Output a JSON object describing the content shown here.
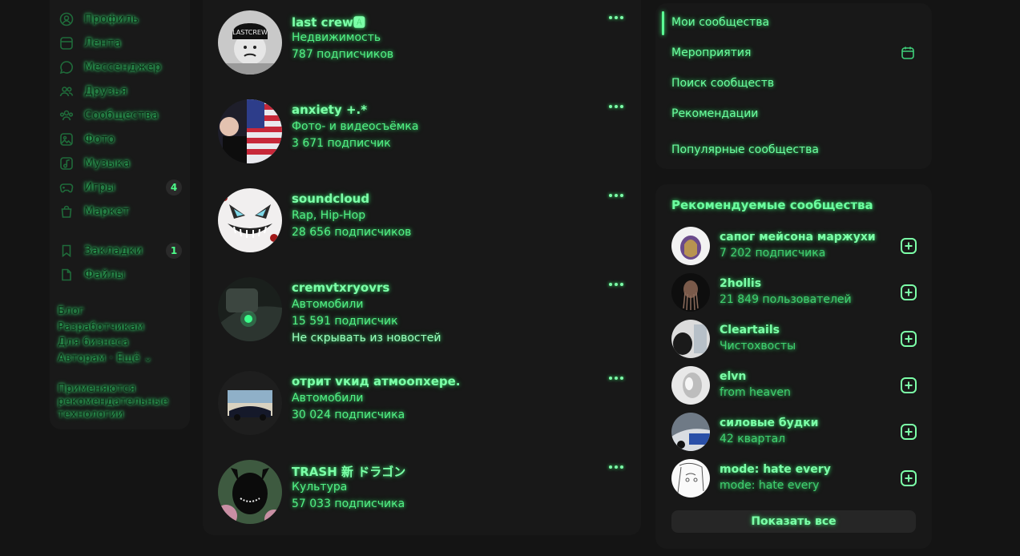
{
  "nav": {
    "items": [
      {
        "label": "Профиль",
        "icon": "user-circle-icon"
      },
      {
        "label": "Лента",
        "icon": "feed-icon"
      },
      {
        "label": "Мессенджер",
        "icon": "chat-bubble-icon"
      },
      {
        "label": "Друзья",
        "icon": "friends-icon"
      },
      {
        "label": "Сообщества",
        "icon": "communities-icon"
      },
      {
        "label": "Фото",
        "icon": "photo-icon"
      },
      {
        "label": "Музыка",
        "icon": "music-icon"
      },
      {
        "label": "Игры",
        "icon": "gamepad-icon",
        "count": "4"
      },
      {
        "label": "Маркет",
        "icon": "shopping-bag-icon"
      },
      {
        "label": "Закладки",
        "icon": "bookmark-icon",
        "count": "1"
      },
      {
        "label": "Файлы",
        "icon": "file-icon"
      }
    ],
    "footer_links": [
      "Блог",
      "Разработчикам",
      "Для бизнеса",
      "Авторам · Ещё ⌄"
    ],
    "footer_note": [
      "Применяются",
      "рекомендательные",
      "технологии"
    ]
  },
  "groups": [
    {
      "name": "last crew🅰",
      "category": "Недвижимость",
      "subscribers": "787 подписчиков"
    },
    {
      "name": "anxiety +.*",
      "category": "Фото- и видеосъёмка",
      "subscribers": "3 671 подписчик"
    },
    {
      "name": "soundcloud",
      "category": "Rap, Hip-Hop",
      "subscribers": "28 656 подписчиков"
    },
    {
      "name": "cremvtxryovrs",
      "category": "Автомобили",
      "subscribers": "15 591 подписчик",
      "hide_label": "Не скрывать из новостей"
    },
    {
      "name": "отрит vкид атмоопхере.",
      "category": "Автомобили",
      "subscribers": "30 024 подписчика"
    },
    {
      "name": "TRASH 新 ドラゴン",
      "category": "Культура",
      "subscribers": "57 033 подписчика"
    }
  ],
  "right_menu": {
    "items": [
      "Мои сообщества",
      "Мероприятия",
      "Поиск сообществ",
      "Рекомендации",
      "Популярные сообщества"
    ]
  },
  "recommended": {
    "title": "Рекомендуемые сообщества",
    "items": [
      {
        "name": "сапог мейсона маржухи",
        "sub": "7 202 подписчика"
      },
      {
        "name": "2hollis",
        "sub": "21 849 пользователей"
      },
      {
        "name": "Cleartails",
        "sub": "Чистохвосты"
      },
      {
        "name": "elvn",
        "sub": "from heaven"
      },
      {
        "name": "силовые будки",
        "sub": "42 квартал"
      },
      {
        "name": "mode: hate every",
        "sub": "mode: hate every"
      }
    ],
    "show_all": "Показать все"
  },
  "colors": {
    "accent": "#4dff8a",
    "background": "#141414",
    "panel": "#181818"
  }
}
